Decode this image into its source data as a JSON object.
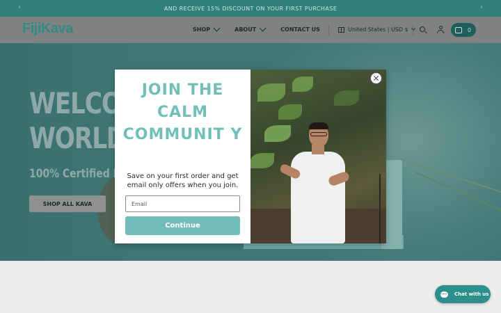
{
  "announcement": {
    "message": "AND RECEIVE 15% DISCOUNT ON YOUR FIRST PURCHASE",
    "prev_icon": "‹",
    "next_icon": "›"
  },
  "header": {
    "logo_text": "FijiKava",
    "nav": [
      {
        "label": "SHOP",
        "has_dropdown": true
      },
      {
        "label": "ABOUT",
        "has_dropdown": true
      },
      {
        "label": "CONTACT US",
        "has_dropdown": false
      }
    ],
    "locale": "United States | USD $",
    "cart_count": "0"
  },
  "hero": {
    "headline_line1": "WELCOM",
    "headline_line2": "WORLD",
    "subheadline": "100% Certified Fiji",
    "cta_label": "SHOP ALL KAVA"
  },
  "popup": {
    "headline": "JOIN THE CALM COMMUNIT Y",
    "description": "Save on your first order and get email only offers when you join.",
    "email_placeholder": "Email",
    "submit_label": "Continue",
    "accent_color": "#72bfba"
  },
  "chat": {
    "label": "Chat with us"
  },
  "colors": {
    "brand_teal": "#2f7f7a",
    "popup_accent": "#72bfba",
    "chat_button": "#2d8f8b"
  }
}
